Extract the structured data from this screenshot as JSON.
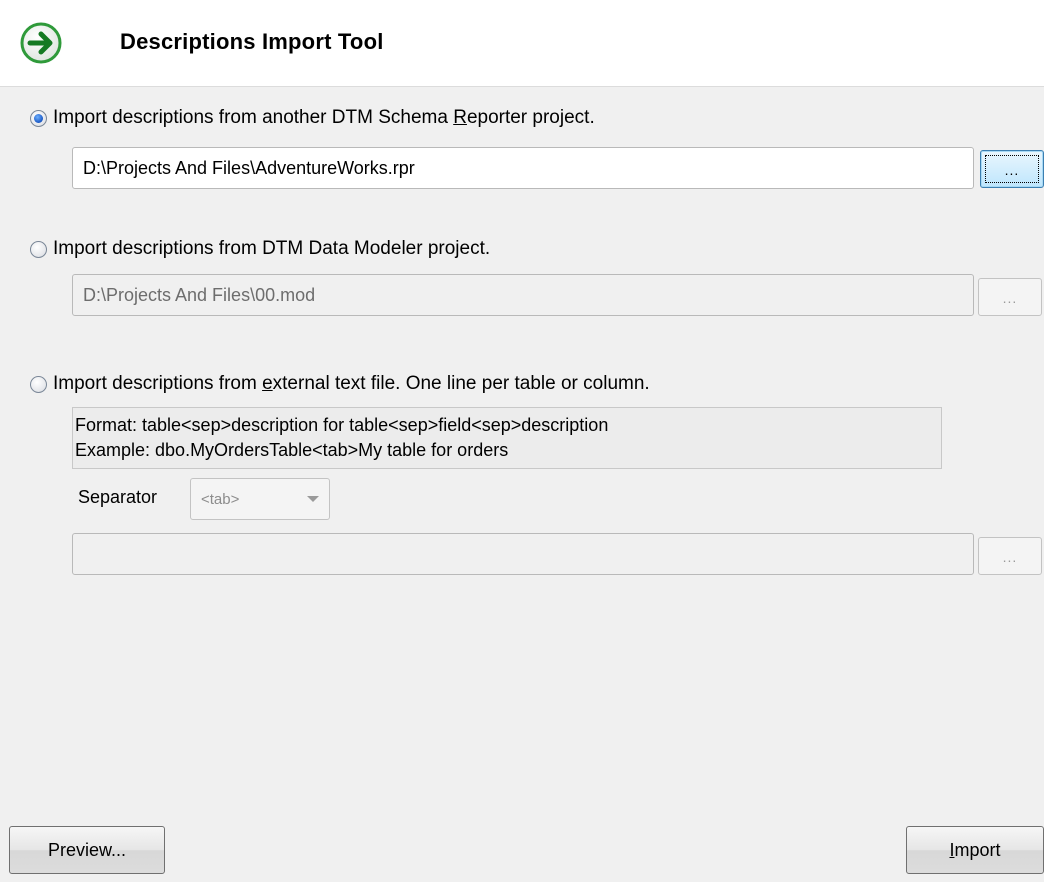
{
  "header": {
    "title": "Descriptions Import Tool",
    "icon": "green-arrow-right-icon",
    "accent_color": "#2f9a3a"
  },
  "options": [
    {
      "label_before": "Import descriptions from another DTM Schema ",
      "label_underlined": "R",
      "label_after": "eporter project.",
      "checked": true,
      "path": "D:\\Projects And Files\\AdventureWorks.rpr",
      "browse_label": "..."
    },
    {
      "label_before": "Import descriptions from DTM Data Modeler project.",
      "label_underlined": "",
      "label_after": "",
      "checked": false,
      "path": "D:\\Projects And Files\\00.mod",
      "browse_label": "..."
    },
    {
      "label_before": "Import descriptions from ",
      "label_underlined": "e",
      "label_after": "xternal text file. One line per table or column.",
      "checked": false,
      "path": "",
      "browse_label": "..."
    }
  ],
  "format_info": {
    "format_line": "Format: table<sep>description for table<sep>field<sep>description",
    "example_line": "Example: dbo.MyOrdersTable<tab>My table for orders"
  },
  "separator": {
    "label": "Separator",
    "selected": "<tab>"
  },
  "footer": {
    "preview_label": "Preview...",
    "import_label_underlined": "I",
    "import_label_rest": "mport"
  }
}
